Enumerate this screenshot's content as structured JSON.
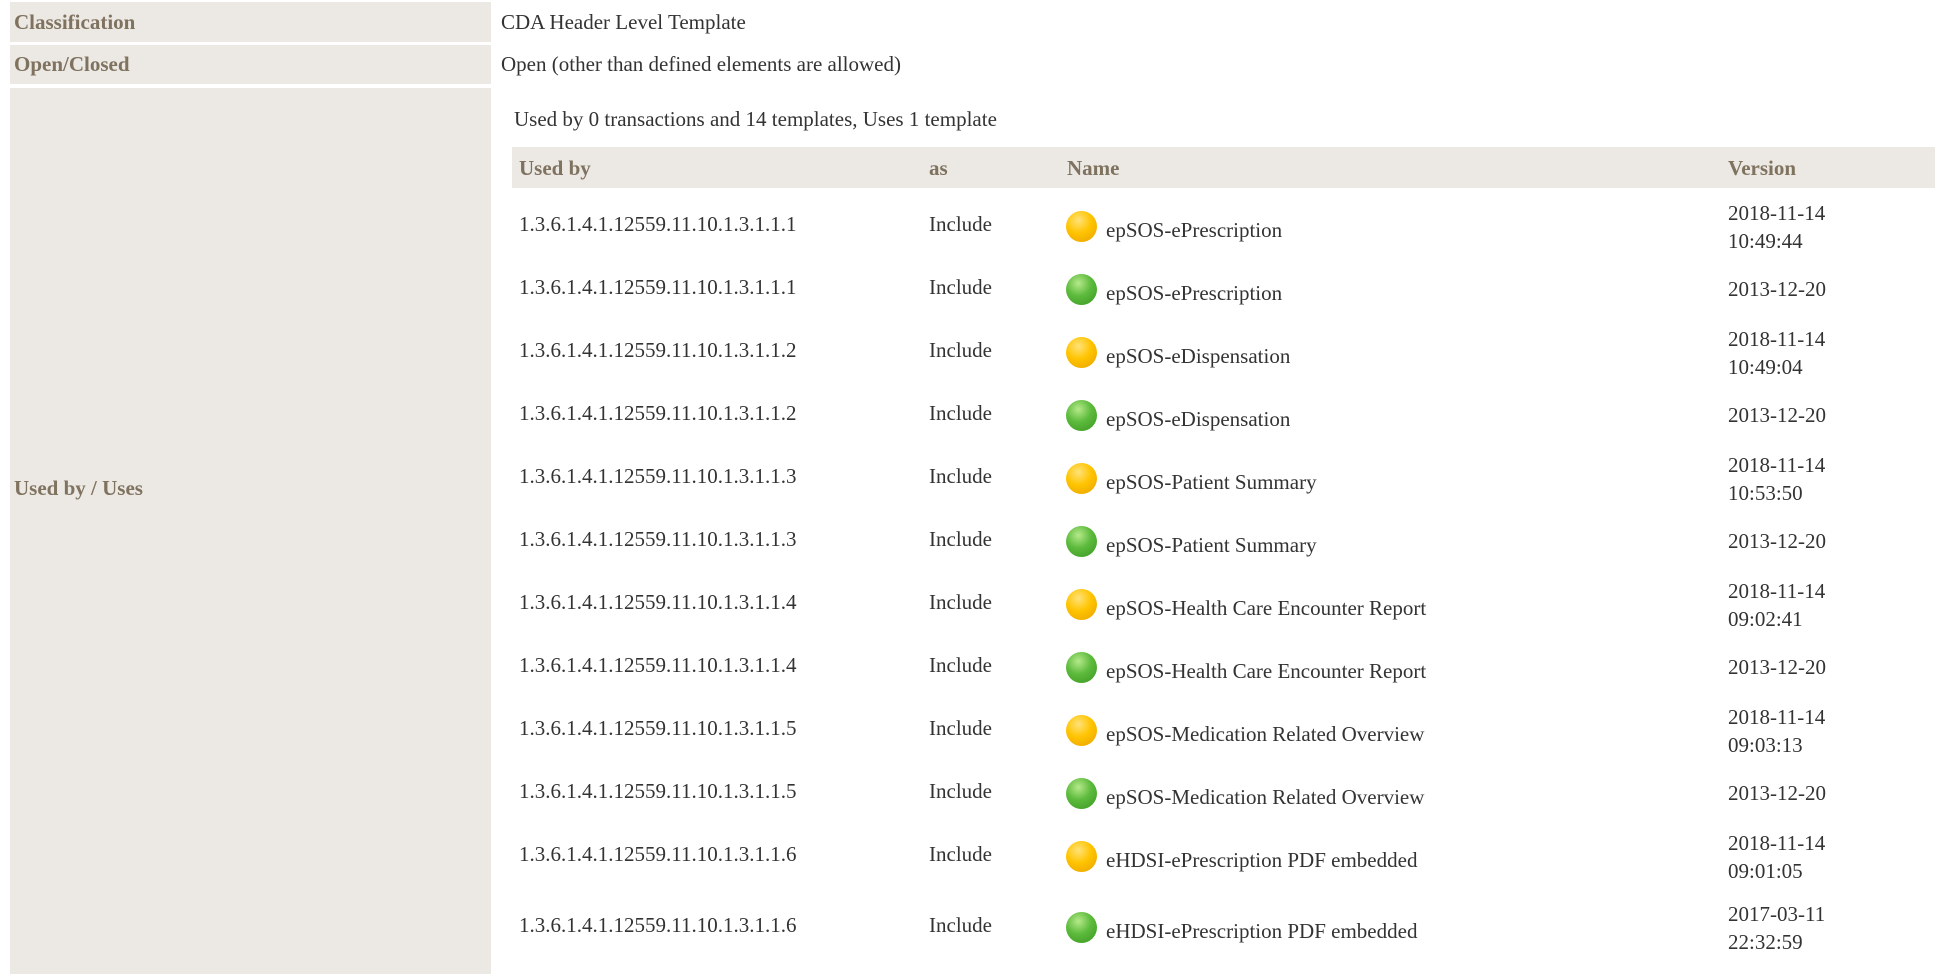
{
  "rows": {
    "classification": {
      "label": "Classification",
      "value": "CDA Header Level Template"
    },
    "open_closed": {
      "label": "Open/Closed",
      "value": "Open (other than defined elements are allowed)"
    },
    "used_by_uses": {
      "label": "Used by / Uses"
    }
  },
  "summary": "Used by 0 transactions and 14 templates, Uses 1 template",
  "table": {
    "headers": {
      "used_by": "Used by",
      "as": "as",
      "name": "Name",
      "version": "Version"
    },
    "rows": [
      {
        "used_by": "1.3.6.1.4.1.12559.11.10.1.3.1.1.1",
        "as": "Include",
        "status": "yellow",
        "name": "epSOS-ePrescription",
        "version_date": "2018-11-14",
        "version_time": "10:49:44"
      },
      {
        "used_by": "1.3.6.1.4.1.12559.11.10.1.3.1.1.1",
        "as": "Include",
        "status": "green",
        "name": "epSOS-ePrescription",
        "version_date": "2013-12-20",
        "version_time": ""
      },
      {
        "used_by": "1.3.6.1.4.1.12559.11.10.1.3.1.1.2",
        "as": "Include",
        "status": "yellow",
        "name": "epSOS-eDispensation",
        "version_date": "2018-11-14",
        "version_time": "10:49:04"
      },
      {
        "used_by": "1.3.6.1.4.1.12559.11.10.1.3.1.1.2",
        "as": "Include",
        "status": "green",
        "name": "epSOS-eDispensation",
        "version_date": "2013-12-20",
        "version_time": ""
      },
      {
        "used_by": "1.3.6.1.4.1.12559.11.10.1.3.1.1.3",
        "as": "Include",
        "status": "yellow",
        "name": "epSOS-Patient Summary",
        "version_date": "2018-11-14",
        "version_time": "10:53:50"
      },
      {
        "used_by": "1.3.6.1.4.1.12559.11.10.1.3.1.1.3",
        "as": "Include",
        "status": "green",
        "name": "epSOS-Patient Summary",
        "version_date": "2013-12-20",
        "version_time": ""
      },
      {
        "used_by": "1.3.6.1.4.1.12559.11.10.1.3.1.1.4",
        "as": "Include",
        "status": "yellow",
        "name": "epSOS-Health Care Encounter Report",
        "version_date": "2018-11-14",
        "version_time": "09:02:41"
      },
      {
        "used_by": "1.3.6.1.4.1.12559.11.10.1.3.1.1.4",
        "as": "Include",
        "status": "green",
        "name": "epSOS-Health Care Encounter Report",
        "version_date": "2013-12-20",
        "version_time": ""
      },
      {
        "used_by": "1.3.6.1.4.1.12559.11.10.1.3.1.1.5",
        "as": "Include",
        "status": "yellow",
        "name": "epSOS-Medication Related Overview",
        "version_date": "2018-11-14",
        "version_time": "09:03:13"
      },
      {
        "used_by": "1.3.6.1.4.1.12559.11.10.1.3.1.1.5",
        "as": "Include",
        "status": "green",
        "name": "epSOS-Medication Related Overview",
        "version_date": "2013-12-20",
        "version_time": ""
      },
      {
        "used_by": "1.3.6.1.4.1.12559.11.10.1.3.1.1.6",
        "as": "Include",
        "status": "yellow",
        "name": "eHDSI-ePrescription PDF embedded",
        "version_date": "2018-11-14",
        "version_time": "09:01:05"
      },
      {
        "used_by": "1.3.6.1.4.1.12559.11.10.1.3.1.1.6",
        "as": "Include",
        "status": "green",
        "name": "eHDSI-ePrescription PDF embedded",
        "version_date": "2017-03-11",
        "version_time": "22:32:59"
      }
    ]
  },
  "colors": {
    "label_bg": "#ece9e4",
    "label_text": "#7f725f",
    "status_yellow": "#ffc400",
    "status_green": "#5cba3c"
  }
}
